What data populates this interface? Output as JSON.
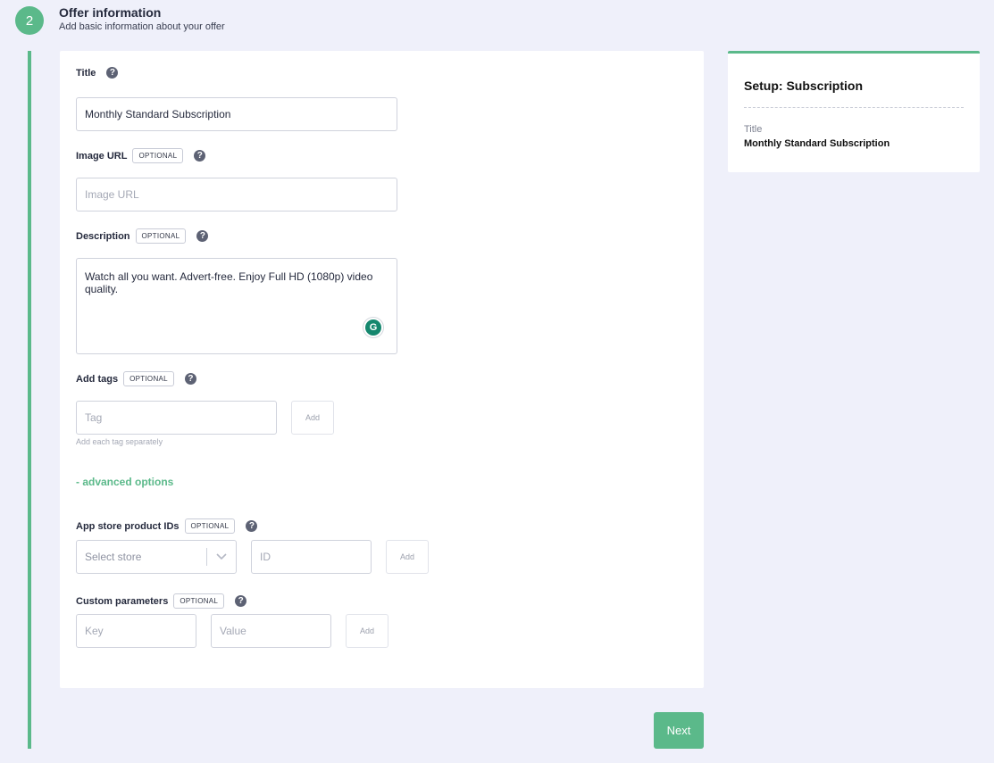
{
  "step": {
    "number": "2",
    "title": "Offer information",
    "subtitle": "Add basic information about your offer"
  },
  "optional_badge": "OPTIONAL",
  "help_glyph": "?",
  "fields": {
    "title": {
      "label": "Title",
      "value": "Monthly Standard Subscription"
    },
    "image_url": {
      "label": "Image URL",
      "placeholder": "Image URL"
    },
    "description": {
      "label": "Description",
      "value": "Watch all you want. Advert-free. Enjoy Full HD (1080p) video quality."
    },
    "tags": {
      "label": "Add tags",
      "placeholder": "Tag",
      "add_label": "Add",
      "hint": "Add each tag separately"
    },
    "app_store": {
      "label": "App store product IDs",
      "select_placeholder": "Select store",
      "id_placeholder": "ID",
      "add_label": "Add"
    },
    "custom_params": {
      "label": "Custom parameters",
      "key_placeholder": "Key",
      "value_placeholder": "Value",
      "add_label": "Add"
    }
  },
  "advanced_toggle": "- advanced options",
  "next_button": "Next",
  "summary": {
    "title": "Setup: Subscription",
    "key": "Title",
    "value": "Monthly Standard Subscription"
  },
  "colors": {
    "accent": "#5bb98a",
    "background": "#eff0fa",
    "grammarly": "#15876e"
  },
  "icons": {
    "help": "question-circle-icon",
    "dropdown": "chevron-down-icon",
    "grammarly": "grammarly-icon"
  }
}
